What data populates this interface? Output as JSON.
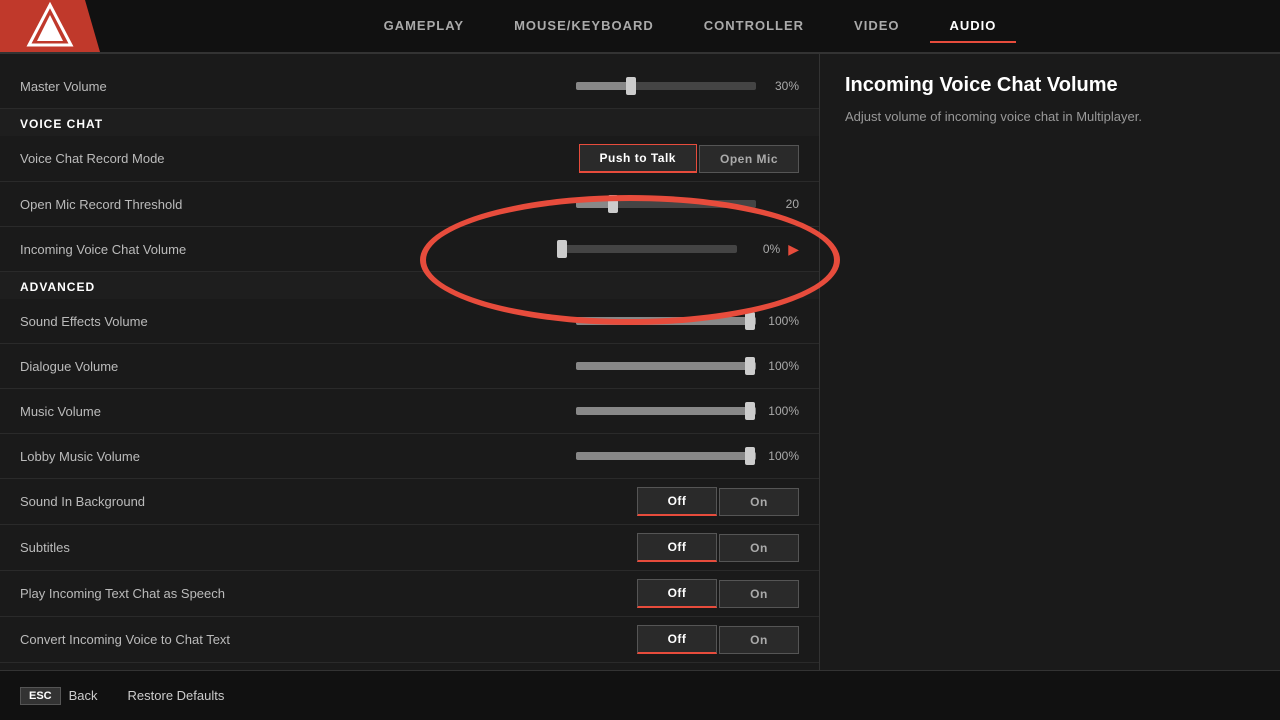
{
  "nav": {
    "tabs": [
      {
        "id": "gameplay",
        "label": "GAMEPLAY",
        "active": false
      },
      {
        "id": "mouse_keyboard",
        "label": "MOUSE/KEYBOARD",
        "active": false
      },
      {
        "id": "controller",
        "label": "CONTROLLER",
        "active": false
      },
      {
        "id": "video",
        "label": "VIDEO",
        "active": false
      },
      {
        "id": "audio",
        "label": "AUDIO",
        "active": true
      }
    ]
  },
  "settings": {
    "master_volume": {
      "label": "Master Volume",
      "value": "30%",
      "fill_pct": 30
    },
    "voice_chat_section": "VOICE CHAT",
    "voice_chat_record_mode": {
      "label": "Voice Chat Record Mode",
      "options": [
        {
          "label": "Push to Talk",
          "selected": true
        },
        {
          "label": "Open Mic",
          "selected": false
        }
      ]
    },
    "open_mic_threshold": {
      "label": "Open Mic Record Threshold",
      "value": "20",
      "fill_pct": 20
    },
    "incoming_voice_volume": {
      "label": "Incoming Voice Chat Volume",
      "value": "0%",
      "fill_pct": 0
    },
    "advanced_section": "ADVANCED",
    "sound_effects_volume": {
      "label": "Sound Effects Volume",
      "value": "100%",
      "fill_pct": 100
    },
    "dialogue_volume": {
      "label": "Dialogue Volume",
      "value": "100%",
      "fill_pct": 100
    },
    "music_volume": {
      "label": "Music Volume",
      "value": "100%",
      "fill_pct": 100
    },
    "lobby_music_volume": {
      "label": "Lobby Music Volume",
      "value": "100%",
      "fill_pct": 100
    },
    "sound_in_background": {
      "label": "Sound In Background",
      "off_label": "Off",
      "on_label": "On"
    },
    "subtitles": {
      "label": "Subtitles",
      "off_label": "Off",
      "on_label": "On"
    },
    "play_incoming_text_chat": {
      "label": "Play Incoming Text Chat as Speech",
      "off_label": "Off",
      "on_label": "On"
    },
    "convert_incoming_voice": {
      "label": "Convert Incoming Voice to Chat Text",
      "off_label": "Off",
      "on_label": "On"
    }
  },
  "info_panel": {
    "title": "Incoming Voice Chat Volume",
    "description": "Adjust volume of incoming voice chat in Multiplayer."
  },
  "bottom_bar": {
    "back_key": "ESC",
    "back_label": "Back",
    "restore_label": "Restore Defaults"
  }
}
